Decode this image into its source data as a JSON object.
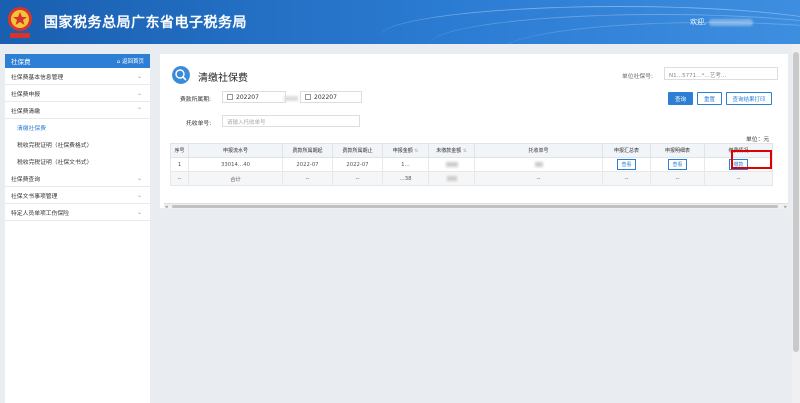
{
  "header": {
    "title": "国家税务总局广东省电子税务局",
    "welcome": "欢迎,"
  },
  "sidebar": {
    "title": "社保费",
    "home_link": "⌂ 返回首页",
    "items": [
      {
        "label": "社保费基本信息管理"
      },
      {
        "label": "社保费申报"
      },
      {
        "label": "社保费清缴",
        "expanded": true,
        "children": [
          {
            "label": "清缴社保费",
            "active": true
          },
          {
            "label": "税收完税证明（社保费格式）"
          },
          {
            "label": "税收完税证明（社保文书式）"
          }
        ]
      },
      {
        "label": "社保费查询"
      },
      {
        "label": "社保文书事项管理"
      },
      {
        "label": "特定人员单项工伤保险"
      }
    ]
  },
  "main": {
    "title": "清缴社保费",
    "unit_code_label": "单位社保号:",
    "unit_code_value": "N1…5771…*…艺考…",
    "period_label": "费款所属期:",
    "date_from": "202207",
    "date_to": "202207",
    "collect_label": "托收单号:",
    "collect_placeholder": "请输入托收单号",
    "buttons": {
      "query": "查询",
      "reset": "重置",
      "print": "查询结果打印"
    },
    "unit_note": "单位：元"
  },
  "table": {
    "headers": [
      "序号",
      "申报流水号",
      "费款所属期起",
      "费款所属期止",
      "申报金额",
      "未缴款金额",
      "托收单号",
      "申报汇总表",
      "申报明细表",
      "缴费情况"
    ],
    "rows": [
      {
        "index": "1",
        "serial": "33014…40",
        "period_start": "2022-07",
        "period_end": "2022-07",
        "amount": "1…",
        "unpaid": "",
        "collect_no": "",
        "summary_btn": "查看",
        "detail_btn": "查看",
        "pay_btn": "缴款"
      }
    ],
    "total_row": {
      "index": "--",
      "serial": "合计",
      "period_start": "--",
      "period_end": "--",
      "amount": "…38",
      "unpaid": "",
      "collect_no": "--",
      "summary": "--",
      "detail": "--",
      "pay": "--"
    }
  },
  "colors": {
    "header_blue": "#1a5fb0",
    "accent": "#2c7fd4",
    "highlight_red": "#e00000"
  }
}
